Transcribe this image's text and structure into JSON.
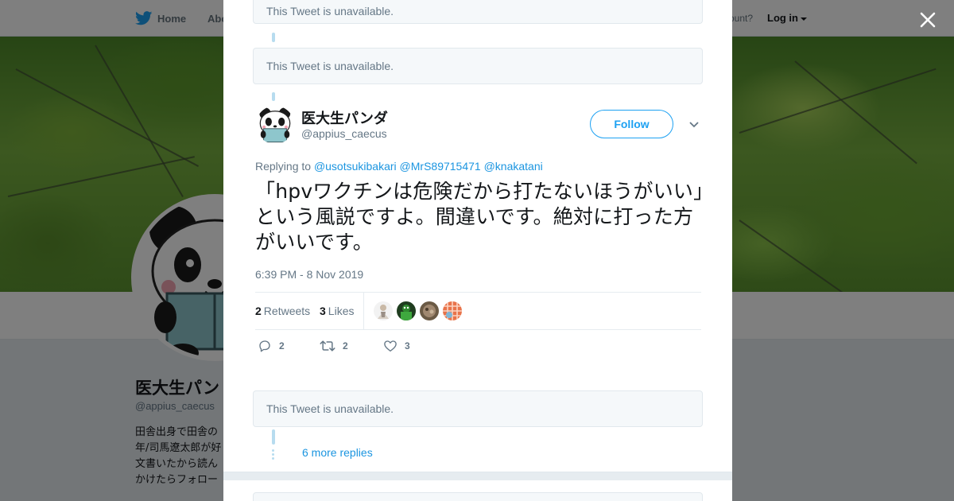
{
  "nav": {
    "home_label": "Home",
    "about_label": "Abo",
    "account_prompt": "ccount?",
    "login_label": "Log in"
  },
  "profile": {
    "name": "医大生パン",
    "handle": "@appius_caecus",
    "bio_lines": [
      "田舎出身で田舎の",
      "年/司馬遼太郎が好",
      "文書いたから読ん",
      "かけたらフォロー"
    ]
  },
  "modal": {
    "unavailable_text": "This Tweet is unavailable.",
    "tweet": {
      "author_name": "医大生パンダ",
      "author_handle": "@appius_caecus",
      "follow_label": "Follow",
      "replying_prefix": "Replying to",
      "mentions": [
        "@usotsukibakari",
        "@MrS89715471",
        "@knakatani"
      ],
      "text": "「hpvワクチンは危険だから打たないほうがいい」という風説ですよ。間違いです。絶対に打った方がいいです。",
      "timestamp": "6:39 PM - 8 Nov 2019",
      "retweets_count": "2",
      "retweets_label": "Retweets",
      "likes_count": "3",
      "likes_label": "Likes",
      "reply_count": "2",
      "retweet_action_count": "2",
      "like_action_count": "3"
    },
    "more_replies_label": "6 more replies"
  },
  "colors": {
    "accent": "#1da1f2",
    "link": "#1b95e0",
    "muted": "#657786",
    "thread_line": "#b7dcef"
  }
}
